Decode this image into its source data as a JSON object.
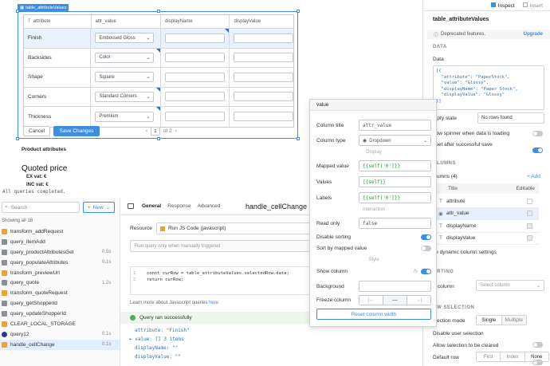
{
  "canvas": {
    "table_tag": "table_attributeValues",
    "columns": [
      "attribute",
      "attr_value",
      "displayName",
      "displayValue"
    ],
    "rows": [
      {
        "attribute": "Finish",
        "attr_value": "Embossed Gloss",
        "selected": true
      },
      {
        "attribute": "Backsides",
        "attr_value": "Color"
      },
      {
        "attribute": "Shape",
        "attr_value": "Square"
      },
      {
        "attribute": "Corners",
        "attr_value": "Standard Corners"
      },
      {
        "attribute": "Thickness",
        "attr_value": "Premium"
      }
    ],
    "cancel_label": "Cancel",
    "save_label": "Save Changes",
    "page_current": "1",
    "page_of": "of 2",
    "product_attributes": "Product attributes",
    "quoted_price": "Quoted price",
    "ex_vat": "EX vat: €",
    "inc_vat": "INC vat: €",
    "status": "All queries completed."
  },
  "left": {
    "search_placeholder": "Search",
    "new_label": "New",
    "showing": "Showing all 18",
    "items": [
      {
        "name": "transform_addRequest",
        "dur": "",
        "kind": "transform"
      },
      {
        "name": "query_itemAdd",
        "dur": "",
        "kind": "query"
      },
      {
        "name": "query_productAttributesGet",
        "dur": "0.5s",
        "kind": "query"
      },
      {
        "name": "query_populateAttributes",
        "dur": "0.1s",
        "kind": "query"
      },
      {
        "name": "transform_previewUrl",
        "dur": "",
        "kind": "transform"
      },
      {
        "name": "query_quote",
        "dur": "1.2s",
        "kind": "query"
      },
      {
        "name": "transform_quoteRequest",
        "dur": "",
        "kind": "transform"
      },
      {
        "name": "query_getShopperId",
        "dur": "",
        "kind": "query"
      },
      {
        "name": "query_updateShopperId",
        "dur": "",
        "kind": "query"
      },
      {
        "name": "CLEAR_LOCAL_STORAGE",
        "dur": "",
        "kind": "storage"
      },
      {
        "name": "query12",
        "dur": "0.1s",
        "kind": "db"
      },
      {
        "name": "handle_cellChange",
        "dur": "0.1s",
        "kind": "transform",
        "selected": true
      }
    ]
  },
  "editor": {
    "tabs": [
      "General",
      "Response",
      "Advanced"
    ],
    "query_title": "handle_cellChange",
    "resource_label": "Resource",
    "resource_value": "Run JS Code (javascript)",
    "trigger": "Run query only when manually triggered",
    "code_line1": "const curRow = table_attributeValues.selectedRow.data;",
    "code_line2": "return curRow;",
    "learn_more": "Learn more about Javascript queries",
    "learn_link": "here",
    "success": "Query ran successfully",
    "result1": "attribute: \"Finish\"",
    "result2": "value: [] 3 items",
    "result3": "displayName: \"\"",
    "result4": "displayValue: \"\""
  },
  "popup": {
    "title": "value",
    "column_title_label": "Column title",
    "column_title_value": "attr_value",
    "column_type_label": "Column type",
    "column_type_value": "Dropdown",
    "display_divider": "Display",
    "mapped_label": "Mapped value",
    "mapped_value": "{{self['0']}}",
    "values_label": "Values",
    "values_value": "{{self}}",
    "labels_label": "Labels",
    "labels_value": "{{self['0']}}",
    "interaction_divider": "Interaction",
    "readonly_label": "Read only",
    "readonly_value": "false",
    "disable_sort_label": "Disable sorting",
    "sort_mapped_label": "Sort by mapped value",
    "style_divider": "Style",
    "show_column_label": "Show column",
    "background_label": "Background",
    "freeze_label": "Freeze column",
    "reset_label": "Reset column width"
  },
  "right": {
    "tab_inspect": "Inspect",
    "tab_insert": "Insert",
    "component": "table_attributeValues",
    "deprecated": "Deprecated features.",
    "upgrade": "Upgrade",
    "data_section": "DATA",
    "data_label": "Data",
    "data_json": "[{\n  \"attribute\": \"PaperStock\",\n  \"value\": \"Glossy\",\n  \"displayName\": \"Paper Stock\",\n  \"displayValue\": \"Glossy\"\n}]",
    "empty_state_label": "mpty state",
    "empty_state_value": "No rows found",
    "spinner_label": "how spinner when data is loading",
    "reset_after_label": "eset after successful save",
    "columns_section": "OLUMNS",
    "columns_count": "olumns (4)",
    "add_label": "+ Add",
    "col_header_title": "Title",
    "col_header_editable": "Editable",
    "column_items": [
      "attribute",
      "attr_value",
      "displayName",
      "displayValue"
    ],
    "dynamic_label": "se dynamic column settings",
    "sorting_section": "ORTING",
    "sort_column_label": "rt column",
    "sort_column_placeholder": "Select column",
    "row_selection_section": "OW SELECTION",
    "selection_mode_label": "election mode",
    "single": "Single",
    "multiple": "Multiple",
    "disable_user_label": "Disable user selection",
    "allow_cleared_label": "Allow selection to be cleared",
    "default_row_label": "Default row",
    "first": "First",
    "index": "Index",
    "none": "None",
    "accent": "#3d8de0"
  }
}
